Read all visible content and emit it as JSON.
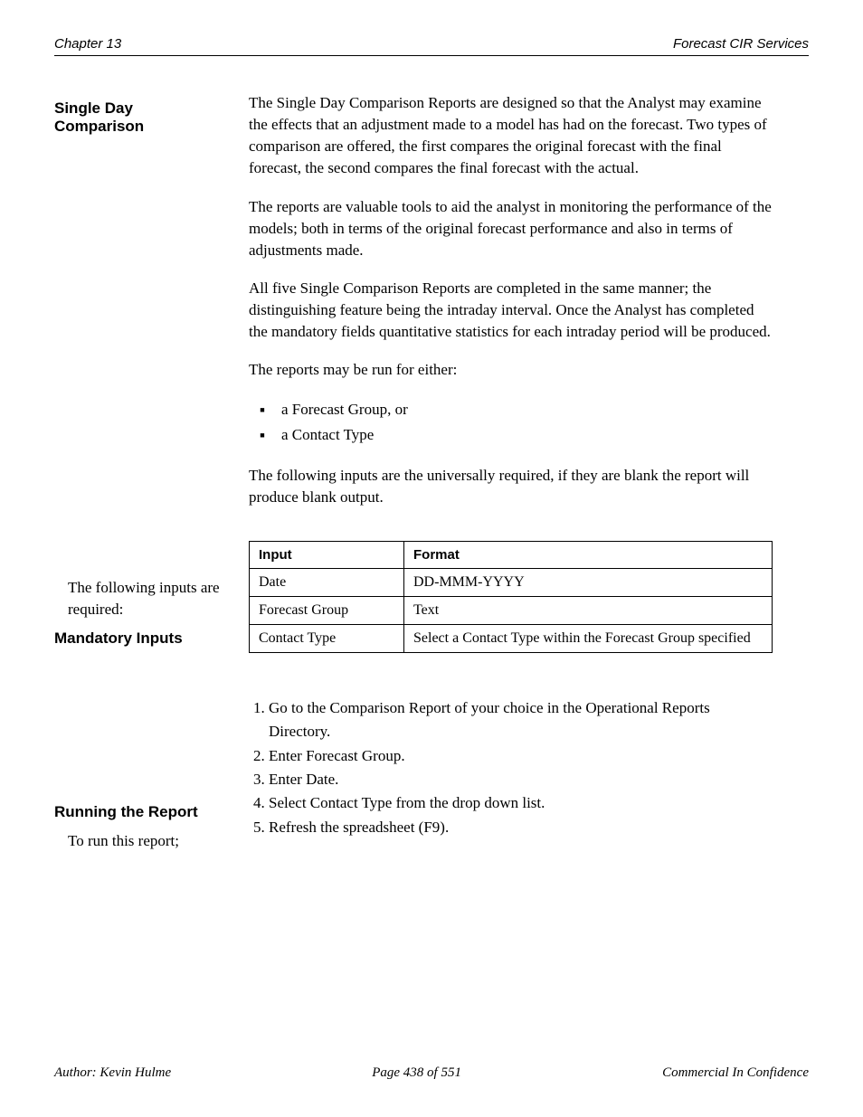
{
  "header": {
    "left": "Chapter 13",
    "right": "Forecast CIR Services"
  },
  "section": {
    "title_line1": "Single Day",
    "title_line2": "Comparison",
    "paragraphs": [
      "The Single Day Comparison Reports are designed so that the Analyst may examine the effects that an adjustment made to a model has had on the forecast. Two types of comparison are offered, the first compares the original forecast with the final forecast, the second compares the final forecast with the actual.",
      "The reports are valuable tools to aid the analyst in monitoring the performance of the models; both in terms of the original forecast performance and also in terms of adjustments made.",
      "All five Single Comparison Reports are completed in the same manner; the distinguishing feature being the intraday interval. Once the Analyst has completed the mandatory fields quantitative statistics for each intraday period will be produced.",
      "The reports may be run for either:"
    ],
    "bullets": [
      "a Forecast Group, or",
      "a Contact Type"
    ],
    "para_after_bullets": "The following inputs are the universally required, if they are blank the report will produce blank output.",
    "inputs_para": "The following inputs are required:",
    "inputs_label": "Mandatory Inputs",
    "table": {
      "headers": [
        "Input",
        "Format"
      ],
      "rows": [
        [
          "Date",
          "DD-MMM-YYYY"
        ],
        [
          "Forecast Group",
          "Text"
        ],
        [
          "Contact Type",
          "Select a Contact Type within the Forecast Group specified"
        ]
      ]
    }
  },
  "running": {
    "title": "Running the Report",
    "lead": "To run this report;",
    "steps": [
      "Go to the Comparison Report of your choice in the Operational Reports Directory.",
      "Enter Forecast Group.",
      "Enter Date.",
      "Select Contact Type from the drop down list.",
      "Refresh the spreadsheet (F9)."
    ]
  },
  "footer": {
    "left": "Author: Kevin Hulme",
    "center": "Page 438 of 551",
    "right": "Commercial In Confidence"
  }
}
